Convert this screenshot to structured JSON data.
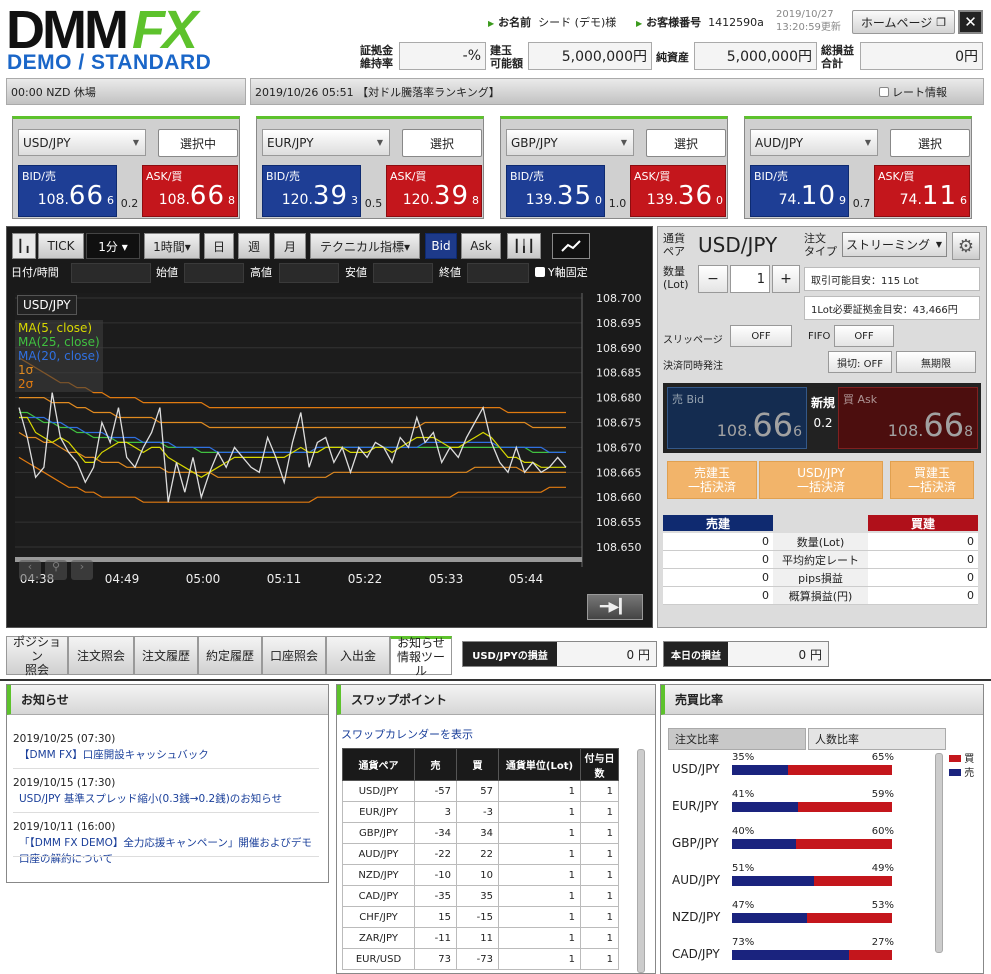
{
  "logo": {
    "main": "DMM",
    "fx": "FX",
    "sub": "DEMO / STANDARD"
  },
  "header": {
    "name_label": "お名前",
    "name_value": "シード (デモ)様",
    "acct_label": "お客様番号",
    "acct_value": "1412590a",
    "date": "2019/10/27",
    "updated": "13:20:59更新",
    "home_btn": "ホームページ",
    "close": "✕"
  },
  "account": [
    {
      "label1": "証拠金",
      "label2": "維持率",
      "value": "-%"
    },
    {
      "label1": "建玉",
      "label2": "可能額",
      "value": "5,000,000円"
    },
    {
      "label1": "純資産",
      "label2": "",
      "value": "5,000,000円"
    },
    {
      "label1": "総損益",
      "label2": "合計",
      "value": "0円"
    }
  ],
  "ticker": {
    "left": "00:00  NZD 休場",
    "center": "2019/10/26 05:51 【対ドル騰落率ランキング】",
    "rate_info": "レート情報"
  },
  "pairs": [
    {
      "name": "USD/JPY",
      "btn": "選択中",
      "bid_pre": "108.",
      "bid_big": "66",
      "bid_sm": "6",
      "ask_pre": "108.",
      "ask_big": "66",
      "ask_sm": "8",
      "spread": "0.2"
    },
    {
      "name": "EUR/JPY",
      "btn": "選択",
      "bid_pre": "120.",
      "bid_big": "39",
      "bid_sm": "3",
      "ask_pre": "120.",
      "ask_big": "39",
      "ask_sm": "8",
      "spread": "0.5"
    },
    {
      "name": "GBP/JPY",
      "btn": "選択",
      "bid_pre": "139.",
      "bid_big": "35",
      "bid_sm": "0",
      "ask_pre": "139.",
      "ask_big": "36",
      "ask_sm": "0",
      "spread": "1.0"
    },
    {
      "name": "AUD/JPY",
      "btn": "選択",
      "bid_pre": "74.",
      "bid_big": "10",
      "bid_sm": "9",
      "ask_pre": "74.",
      "ask_big": "11",
      "ask_sm": "6",
      "spread": "0.7"
    }
  ],
  "price_labels": {
    "bid": "BID/売",
    "ask": "ASK/買"
  },
  "chart_toolbar": {
    "tick": "TICK",
    "m1": "1分 ▾",
    "h1": "1時間▾",
    "day": "日",
    "week": "週",
    "month": "月",
    "tech": "テクニカル指標▾",
    "bid": "Bid",
    "ask": "Ask"
  },
  "ohlc": {
    "date": "日付/時間",
    "open": "始値",
    "high": "高値",
    "low": "安値",
    "close": "終値",
    "yfix": "Y軸固定"
  },
  "chart_data": {
    "type": "line",
    "symbol": "USD/JPY",
    "legend": [
      "MA(5, close)",
      "MA(25, close)",
      "MA(20, close)",
      "1σ",
      "2σ"
    ],
    "x_ticks": [
      "04:38",
      "04:49",
      "05:00",
      "05:11",
      "05:22",
      "05:33",
      "05:44"
    ],
    "y_ticks": [
      "108.700",
      "108.695",
      "108.690",
      "108.685",
      "108.680",
      "108.675",
      "108.670",
      "108.665",
      "108.660",
      "108.655",
      "108.650"
    ],
    "ylim": [
      108.648,
      108.701
    ],
    "series": [
      {
        "name": "price",
        "color": "#dddddd",
        "values": [
          108.678,
          108.672,
          108.664,
          108.666,
          108.681,
          108.672,
          108.669,
          108.667,
          108.663,
          108.666,
          108.675,
          108.671,
          108.678,
          108.668,
          108.666,
          108.67,
          108.673,
          108.678,
          108.659,
          108.667,
          108.661,
          108.668,
          108.66,
          108.665,
          108.669,
          108.666,
          108.67,
          108.668,
          108.666,
          108.665,
          108.672,
          108.668,
          108.663,
          108.671,
          108.677,
          108.666,
          108.671,
          108.672,
          108.667,
          108.67,
          108.665,
          108.67,
          108.668,
          108.671,
          108.67,
          108.667,
          108.672,
          108.67,
          108.676,
          108.671,
          108.673,
          108.667,
          108.67,
          108.668,
          108.672,
          108.675,
          108.678,
          108.671,
          108.667,
          108.665,
          108.67,
          108.665,
          108.667,
          108.665,
          108.666,
          108.668,
          108.666
        ]
      },
      {
        "name": "MA(5, close)",
        "color": "#d8d800",
        "values": [
          108.676,
          108.676,
          108.673,
          108.672,
          108.671,
          108.672,
          108.671,
          108.669,
          108.667,
          108.667,
          108.669,
          108.67,
          108.671,
          108.671,
          108.67,
          108.669,
          108.67,
          108.67,
          108.668,
          108.667,
          108.666,
          108.665,
          108.664,
          108.665,
          108.666,
          108.667,
          108.668,
          108.668,
          108.668,
          108.668,
          108.668,
          108.668,
          108.668,
          108.669,
          108.67,
          108.669,
          108.669,
          108.67,
          108.67,
          108.67,
          108.669,
          108.669,
          108.669,
          108.67,
          108.67,
          108.669,
          108.67,
          108.671,
          108.672,
          108.672,
          108.672,
          108.671,
          108.67,
          108.67,
          108.671,
          108.672,
          108.673,
          108.672,
          108.67,
          108.668,
          108.668,
          108.667,
          108.667,
          108.666,
          108.666,
          108.666,
          108.666
        ]
      },
      {
        "name": "MA(25, close)",
        "color": "#40c040",
        "values": [
          108.677,
          108.677,
          108.676,
          108.675,
          108.675,
          108.674,
          108.674,
          108.673,
          108.673,
          108.672,
          108.672,
          108.672,
          108.671,
          108.671,
          108.671,
          108.671,
          108.671,
          108.671,
          108.67,
          108.67,
          108.67,
          108.67,
          108.669,
          108.669,
          108.669,
          108.669,
          108.669,
          108.669,
          108.669,
          108.669,
          108.669,
          108.669,
          108.669,
          108.669,
          108.669,
          108.669,
          108.669,
          108.67,
          108.67,
          108.67,
          108.67,
          108.67,
          108.67,
          108.67,
          108.67,
          108.67,
          108.67,
          108.67,
          108.67,
          108.67,
          108.67,
          108.67,
          108.67,
          108.67,
          108.67,
          108.67,
          108.67,
          108.67,
          108.67,
          108.67,
          108.67,
          108.67,
          108.669,
          108.669,
          108.669,
          108.669,
          108.669
        ]
      },
      {
        "name": "MA(20, close)",
        "color": "#3070e0",
        "values": [
          108.676,
          108.676,
          108.676,
          108.676,
          108.675,
          108.675,
          108.674,
          108.674,
          108.673,
          108.673,
          108.673,
          108.672,
          108.672,
          108.672,
          108.672,
          108.671,
          108.671,
          108.671,
          108.671,
          108.67,
          108.67,
          108.67,
          108.67,
          108.67,
          108.669,
          108.669,
          108.669,
          108.669,
          108.669,
          108.669,
          108.669,
          108.669,
          108.669,
          108.669,
          108.669,
          108.669,
          108.67,
          108.67,
          108.67,
          108.67,
          108.67,
          108.67,
          108.67,
          108.67,
          108.67,
          108.67,
          108.67,
          108.67,
          108.67,
          108.671,
          108.671,
          108.671,
          108.671,
          108.671,
          108.671,
          108.671,
          108.671,
          108.671,
          108.67,
          108.67,
          108.67,
          108.67,
          108.67,
          108.67,
          108.669,
          108.669,
          108.669
        ]
      },
      {
        "name": "+1σ",
        "color": "#e08a20",
        "values": [
          108.68,
          108.68,
          108.68,
          108.68,
          108.679,
          108.679,
          108.679,
          108.678,
          108.678,
          108.677,
          108.677,
          108.677,
          108.676,
          108.676,
          108.676,
          108.676,
          108.676,
          108.675,
          108.675,
          108.675,
          108.675,
          108.675,
          108.675,
          108.674,
          108.674,
          108.674,
          108.674,
          108.674,
          108.674,
          108.674,
          108.674,
          108.674,
          108.674,
          108.674,
          108.674,
          108.674,
          108.674,
          108.674,
          108.674,
          108.674,
          108.674,
          108.674,
          108.674,
          108.674,
          108.674,
          108.674,
          108.674,
          108.674,
          108.674,
          108.675,
          108.675,
          108.675,
          108.675,
          108.675,
          108.675,
          108.675,
          108.675,
          108.675,
          108.675,
          108.675,
          108.675,
          108.675,
          108.674,
          108.674,
          108.674,
          108.674,
          108.674
        ]
      },
      {
        "name": "-1σ",
        "color": "#e08a20",
        "values": [
          108.673,
          108.672,
          108.672,
          108.671,
          108.671,
          108.67,
          108.669,
          108.669,
          108.668,
          108.668,
          108.667,
          108.667,
          108.667,
          108.666,
          108.666,
          108.666,
          108.666,
          108.666,
          108.665,
          108.665,
          108.665,
          108.665,
          108.665,
          108.665,
          108.664,
          108.664,
          108.664,
          108.664,
          108.664,
          108.664,
          108.664,
          108.664,
          108.664,
          108.664,
          108.664,
          108.664,
          108.664,
          108.664,
          108.665,
          108.665,
          108.665,
          108.665,
          108.665,
          108.665,
          108.665,
          108.665,
          108.665,
          108.665,
          108.665,
          108.665,
          108.665,
          108.665,
          108.665,
          108.665,
          108.665,
          108.666,
          108.666,
          108.666,
          108.666,
          108.666,
          108.666,
          108.665,
          108.665,
          108.665,
          108.665,
          108.665,
          108.665
        ]
      },
      {
        "name": "+2σ",
        "color": "#e07a10",
        "values": [
          108.688,
          108.687,
          108.686,
          108.685,
          108.684,
          108.683,
          108.683,
          108.682,
          108.682,
          108.681,
          108.681,
          108.68,
          108.68,
          108.68,
          108.68,
          108.679,
          108.679,
          108.679,
          108.679,
          108.679,
          108.679,
          108.679,
          108.679,
          108.678,
          108.678,
          108.678,
          108.678,
          108.678,
          108.678,
          108.678,
          108.678,
          108.678,
          108.678,
          108.678,
          108.678,
          108.678,
          108.678,
          108.678,
          108.678,
          108.678,
          108.678,
          108.678,
          108.678,
          108.678,
          108.678,
          108.678,
          108.678,
          108.678,
          108.678,
          108.678,
          108.678,
          108.678,
          108.678,
          108.678,
          108.678,
          108.678,
          108.678,
          108.678,
          108.678,
          108.677,
          108.677,
          108.677,
          108.677,
          108.677,
          108.677,
          108.677,
          108.677
        ]
      },
      {
        "name": "-2σ",
        "color": "#e07a10",
        "values": [
          108.668,
          108.667,
          108.666,
          108.665,
          108.664,
          108.663,
          108.662,
          108.662,
          108.661,
          108.661,
          108.66,
          108.66,
          108.66,
          108.66,
          108.66,
          108.659,
          108.659,
          108.659,
          108.659,
          108.659,
          108.659,
          108.659,
          108.659,
          108.659,
          108.659,
          108.659,
          108.659,
          108.659,
          108.659,
          108.659,
          108.659,
          108.659,
          108.659,
          108.659,
          108.659,
          108.659,
          108.66,
          108.66,
          108.66,
          108.66,
          108.66,
          108.66,
          108.66,
          108.66,
          108.66,
          108.66,
          108.66,
          108.66,
          108.66,
          108.66,
          108.66,
          108.66,
          108.66,
          108.661,
          108.661,
          108.661,
          108.661,
          108.661,
          108.661,
          108.661,
          108.661,
          108.661,
          108.661,
          108.661,
          108.662,
          108.662,
          108.662
        ]
      }
    ]
  },
  "order": {
    "pair_label1": "通貨",
    "pair_label2": "ペア",
    "pair": "USD/JPY",
    "type_label1": "注文",
    "type_label2": "タイプ",
    "type": "ストリーミング",
    "qty_label1": "数量",
    "qty_label2": "(Lot)",
    "minus": "−",
    "qty": "1",
    "plus": "+",
    "available": "取引可能目安：115 Lot",
    "margin": "1Lot必要証拠金目安：43,466円",
    "slippage": "スリッページ",
    "slip_val": "OFF",
    "fifo": "FIFO",
    "fifo_val": "OFF",
    "settle": "決済同時発注",
    "stop": "損切: OFF",
    "unlimited": "無期限",
    "sell_label": "売 Bid",
    "buy_label": "買 Ask",
    "new_label": "新規",
    "spread": "0.2",
    "sell_pre": "108.",
    "sell_big": "66",
    "sell_sm": "6",
    "buy_pre": "108.",
    "buy_big": "66",
    "buy_sm": "8"
  },
  "bulk": {
    "sell": [
      "売建玉",
      "一括決済"
    ],
    "pair": [
      "USD/JPY",
      "一括決済"
    ],
    "buy": [
      "買建玉",
      "一括決済"
    ]
  },
  "positions": {
    "sell_h": "売建",
    "buy_h": "買建",
    "rows": [
      {
        "l": "0",
        "m": "数量(Lot)",
        "r": "0"
      },
      {
        "l": "0",
        "m": "平均約定レート",
        "r": "0"
      },
      {
        "l": "0",
        "m": "pips損益",
        "r": "0"
      },
      {
        "l": "0",
        "m": "概算損益(円)",
        "r": "0"
      }
    ]
  },
  "tabs": [
    {
      "l1": "ポジション",
      "l2": "照会"
    },
    {
      "l1": "注文照会",
      "l2": ""
    },
    {
      "l1": "注文履歴",
      "l2": ""
    },
    {
      "l1": "約定履歴",
      "l2": ""
    },
    {
      "l1": "口座照会",
      "l2": ""
    },
    {
      "l1": "入出金",
      "l2": ""
    },
    {
      "l1": "お知らせ",
      "l2": "情報ツール"
    }
  ],
  "pnl": {
    "pair_label": "USD/JPYの損益",
    "pair_value": "0 円",
    "day_label": "本日の損益",
    "day_value": "0 円"
  },
  "news": {
    "title": "お知らせ",
    "items": [
      {
        "date": "2019/10/25  (07:30)",
        "text": "【DMM FX】口座開設キャッシュバック"
      },
      {
        "date": "2019/10/15  (17:30)",
        "text": "USD/JPY 基準スプレッド縮小(0.3銭→0.2銭)のお知らせ"
      },
      {
        "date": "2019/10/11  (16:00)",
        "text": "「【DMM FX DEMO】全力応援キャンペーン」開催およびデモ口座の解約について"
      }
    ]
  },
  "swap": {
    "title": "スワップポイント",
    "calendar": "スワップカレンダーを表示",
    "headers": [
      "通貨ペア",
      "売",
      "買",
      "通貨単位(Lot)",
      "付与日数"
    ],
    "rows": [
      [
        "USD/JPY",
        "-57",
        "57",
        "1",
        "1"
      ],
      [
        "EUR/JPY",
        "3",
        "-3",
        "1",
        "1"
      ],
      [
        "GBP/JPY",
        "-34",
        "34",
        "1",
        "1"
      ],
      [
        "AUD/JPY",
        "-22",
        "22",
        "1",
        "1"
      ],
      [
        "NZD/JPY",
        "-10",
        "10",
        "1",
        "1"
      ],
      [
        "CAD/JPY",
        "-35",
        "35",
        "1",
        "1"
      ],
      [
        "CHF/JPY",
        "15",
        "-15",
        "1",
        "1"
      ],
      [
        "ZAR/JPY",
        "-11",
        "11",
        "1",
        "1"
      ],
      [
        "EUR/USD",
        "73",
        "-73",
        "1",
        "1"
      ]
    ]
  },
  "ratio": {
    "title": "売買比率",
    "tab1": "注文比率",
    "tab2": "人数比率",
    "legend_buy": "買",
    "legend_sell": "売",
    "colors": {
      "buy": "#c4161c",
      "sell": "#1a237e"
    },
    "rows": [
      {
        "pair": "USD/JPY",
        "left": "35%",
        "right": "65%",
        "sell_frac": 0.35
      },
      {
        "pair": "EUR/JPY",
        "left": "41%",
        "right": "59%",
        "sell_frac": 0.41
      },
      {
        "pair": "GBP/JPY",
        "left": "40%",
        "right": "60%",
        "sell_frac": 0.4
      },
      {
        "pair": "AUD/JPY",
        "left": "51%",
        "right": "49%",
        "sell_frac": 0.51
      },
      {
        "pair": "NZD/JPY",
        "left": "47%",
        "right": "53%",
        "sell_frac": 0.47
      },
      {
        "pair": "CAD/JPY",
        "left": "73%",
        "right": "27%",
        "sell_frac": 0.73
      }
    ]
  }
}
